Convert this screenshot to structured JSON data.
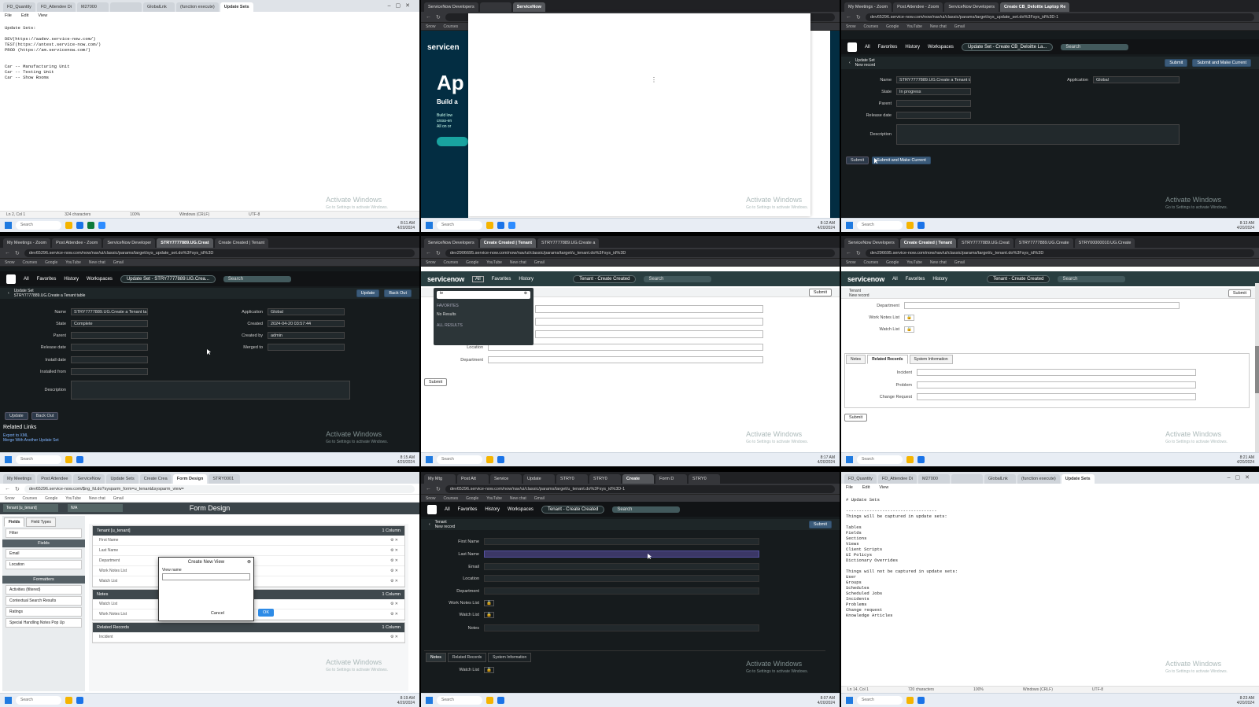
{
  "t1": {
    "tabs": [
      "FD_Quantity",
      "FD_Attendee Di",
      "M27000",
      "",
      "GlobalLnk",
      "(function execute)",
      "Update Sets"
    ],
    "menu": [
      "File",
      "Edit",
      "View"
    ],
    "body": "Update Sets:\n\nDEV(https://aadev.service-now.com/)\nTEST(https://antest.service-now.com/)\nPROD (https://am.servicenow.com/)\n\n\nCar -- Manufacturing Unit\nCar -- Testing Unit\nCar -- Show Rooms",
    "status": [
      "Ln 2, Col 1",
      "324 characters",
      "",
      "100%",
      "Windows (CRLF)",
      "UTF-8"
    ]
  },
  "t2": {
    "tabs": [
      "ServiceNow Developers",
      "",
      "ServiceNow"
    ],
    "brand": "servicen",
    "hero_big": "Ap",
    "hero_line1": "Build a",
    "hero_line2": "Build low",
    "hero_line3": "cross-en",
    "hero_line4": "All on or"
  },
  "t3": {
    "tabs": [
      "My Meetings - Zoom",
      "Post Attendee - Zoom",
      "ServiceNow Developers",
      "Create CB_Deloitte Laptop Re"
    ],
    "url": "dev65296.service-now.com/now/nav/ui/classic/params/target/sys_update_set.do%3Fsys_id%3D-1",
    "bookmarks": [
      "Snow",
      "Courses",
      "Google",
      "YouTube",
      "New chat",
      "Gmail"
    ],
    "nav": [
      "All",
      "Favorites",
      "History",
      "Workspaces"
    ],
    "pill": "Update Set - Create CB_Deloitte La...",
    "search": "Search",
    "sub_title": "Update Set",
    "sub_sub": "New record",
    "actions": [
      "Submit",
      "Submit and Make Current"
    ],
    "fields": {
      "name_label": "Name",
      "name": "STRY7777889.UG.Create a Tenant tal",
      "state_label": "State",
      "state": "In progress",
      "parent_label": "Parent",
      "release_label": "Release date",
      "desc_label": "Description",
      "app_label": "Application",
      "app": "Global"
    },
    "buttons": [
      "Submit",
      "Submit and Make Current"
    ]
  },
  "t4": {
    "tabs": [
      "My Meetings - Zoom",
      "Post Attendee - Zoom",
      "ServiceNow Developer",
      "STRY7777889.UG.Creat",
      "Create Created | Tenant"
    ],
    "url": "dev65296.service-now.com/now/nav/ui/classic/params/target/sys_update_set.do%3Fsys_id%3D",
    "bookmarks": [
      "Snow",
      "Courses",
      "Google",
      "YouTube",
      "New chat",
      "Gmail"
    ],
    "nav": [
      "All",
      "Favorites",
      "History",
      "Workspaces"
    ],
    "pill": "Update Set - STRY7777889.UG.Crea...",
    "search": "Search",
    "sub_title": "Update Set",
    "sub_sub": "STRY7777889.UG.Create a Tenant table",
    "actions": [
      "Update",
      "Back Out"
    ],
    "fields": {
      "name_label": "Name",
      "name": "STRY7777889.UG.Create a Tenant ta",
      "state_label": "State",
      "state": "Complete",
      "parent_label": "Parent",
      "release_label": "Release date",
      "install_label": "Install date",
      "installed_label": "Installed from",
      "desc_label": "Description",
      "app_label": "Application",
      "app": "Global",
      "created_label": "Created",
      "created": "2024-04-20 03:57:44",
      "createdby_label": "Created by",
      "createdby": "admin",
      "merged_label": "Merged to"
    },
    "buttons": [
      "Update",
      "Back Out"
    ],
    "related_title": "Related Links",
    "related": [
      "Export to XML",
      "Merge With Another Update Set"
    ]
  },
  "t5": {
    "tabs": [
      "ServiceNow Developers",
      "Create Created | Tenant",
      "STRY7777889.UG.Create a"
    ],
    "url": "dev2906695.service-now.com/now/nav/ui/classic/params/target/u_tenant.do%3Fsys_id%3D",
    "bookmarks": [
      "Snow",
      "Courses",
      "Google",
      "YouTube",
      "New chat",
      "Gmail"
    ],
    "brand": "servicenow",
    "nav": [
      "All",
      "Favorites",
      "History"
    ],
    "pill": "Tenant - Create Created",
    "search": "Search",
    "filter_value": "te",
    "favorites": "FAVORITES",
    "no_results": "No Results",
    "all_results": "ALL RESULTS",
    "location_label": "Location",
    "dept_label": "Department",
    "submit": "Submit"
  },
  "t6": {
    "tabs": [
      "ServiceNow Developers",
      "Create Created | Tenant",
      "STRY7777889.UG.Creat",
      "STRY7777889.UG.Create",
      "STRY00000010.UG.Create"
    ],
    "url": "dev296695.service-now.com/now/nav/ui/classic/params/target/u_tenant.do%3Fsys_id%3D",
    "bookmarks": [
      "Snow",
      "Courses",
      "Google",
      "YouTube",
      "New chat",
      "Gmail"
    ],
    "brand": "servicenow",
    "nav": [
      "All",
      "Favorites",
      "History"
    ],
    "pill": "Tenant - Create Created",
    "search": "Search",
    "sub_title": "Tenant",
    "sub_sub": "New record",
    "dept_label": "Department",
    "worknotes_label": "Work Notes List",
    "watch_label": "Watch List",
    "tabs_inner": [
      "Notes",
      "Related Records",
      "System Information"
    ],
    "incident_label": "Incident",
    "problem_label": "Problem",
    "change_label": "Change Request",
    "submit": "Submit"
  },
  "t7": {
    "tabs": [
      "My Meetings",
      "Post Attendee",
      "ServiceNow",
      "Update Sets",
      "Create Crea",
      "Form Design",
      "STRY0001"
    ],
    "url": "dev65296.service-now.com/$ng_fd.do?sysparm_form=u_tenant&sysparm_view=",
    "bookmarks": [
      "Snow",
      "Courses",
      "Google",
      "YouTube",
      "New chat",
      "Gmail"
    ],
    "table_select": "Tenant [u_tenant]",
    "view_select": "N/A",
    "title": "Form Design",
    "left_tabs": [
      "Fields",
      "Field Types"
    ],
    "filter": "Filter",
    "fields_head": "Fields",
    "left_fields": [
      "Email",
      "Location"
    ],
    "formatters_head": "Formatters",
    "formatters": [
      "Activities (filtered)",
      "Contextual Search Results",
      "Ratings",
      "Special Handling Notes Pop Up"
    ],
    "sections": [
      {
        "title": "Tenant [u_tenant]",
        "cols": "1 Column",
        "fields": [
          "First Name",
          "Last Name",
          "Department",
          "Work Notes List",
          "Watch List"
        ]
      },
      {
        "title": "Notes",
        "cols": "1 Column",
        "fields": [
          "Watch List",
          "Work Notes List"
        ]
      },
      {
        "title": "Related Records",
        "cols": "1 Column",
        "fields": [
          "Incident"
        ]
      }
    ],
    "modal_title": "Create New View",
    "modal_label": "View name",
    "modal_cancel": "Cancel",
    "modal_ok": "OK"
  },
  "t8": {
    "tabs": [
      "My Mtg",
      "Post Att",
      "Service",
      "Update",
      "STRY0",
      "STRY0",
      "Create",
      "Form D",
      "STRY0"
    ],
    "url": "dev65296.service-now.com/now/nav/ui/classic/params/target/u_tenant.do%3Fsys_id%3D-1",
    "bookmarks": [
      "Snow",
      "Courses",
      "Google",
      "YouTube",
      "New chat",
      "Gmail"
    ],
    "nav": [
      "All",
      "Favorites",
      "History",
      "Workspaces"
    ],
    "pill": "Tenant - Create Created",
    "search": "Search",
    "sub_title": "Tenant",
    "sub_sub": "New record",
    "submit": "Submit",
    "fields": [
      "First Name",
      "Last Name",
      "Email",
      "Location",
      "Department",
      "Work Notes List",
      "Watch List",
      "Notes"
    ],
    "tabs_inner": [
      "Notes",
      "Related Records",
      "System Information"
    ],
    "bottom_field": "Watch List"
  },
  "t9": {
    "tabs": [
      "FD_Quantity",
      "FD_Attendee Di",
      "M27000",
      "",
      "GlobalLnk",
      "(function execute)",
      "Update Sets"
    ],
    "menu": [
      "File",
      "Edit",
      "View"
    ],
    "body": "# Update Sets\n\n-----------------------------------\nThings will be captured in update sets:\n\nTables\nFields\nSections\nViews\nClient Scripts\nUI Policys\nDictionary Overrides\n\nThings will not be captured in update sets:\nUser\nGroups\nSchedules\nScheduled Jobs\nIncidents\nProblems\nChange request\nKnowledge Articles",
    "status": [
      "Ln 14, Col 1",
      "720 characters",
      "",
      "100%",
      "Windows (CRLF)",
      "UTF-8"
    ]
  },
  "common": {
    "watermark": "Activate Windows",
    "watermark_sub": "Go to Settings to activate Windows.",
    "search": "Search",
    "lang": "ENG",
    "region": "IN",
    "clocks": [
      "8:11 AM",
      "8:12 AM",
      "8:13 AM",
      "8:15 AM",
      "8:17 AM",
      "8:21 AM",
      "8:19 AM",
      "8:07 AM",
      "8:23 AM"
    ],
    "date": "4/20/2024"
  }
}
